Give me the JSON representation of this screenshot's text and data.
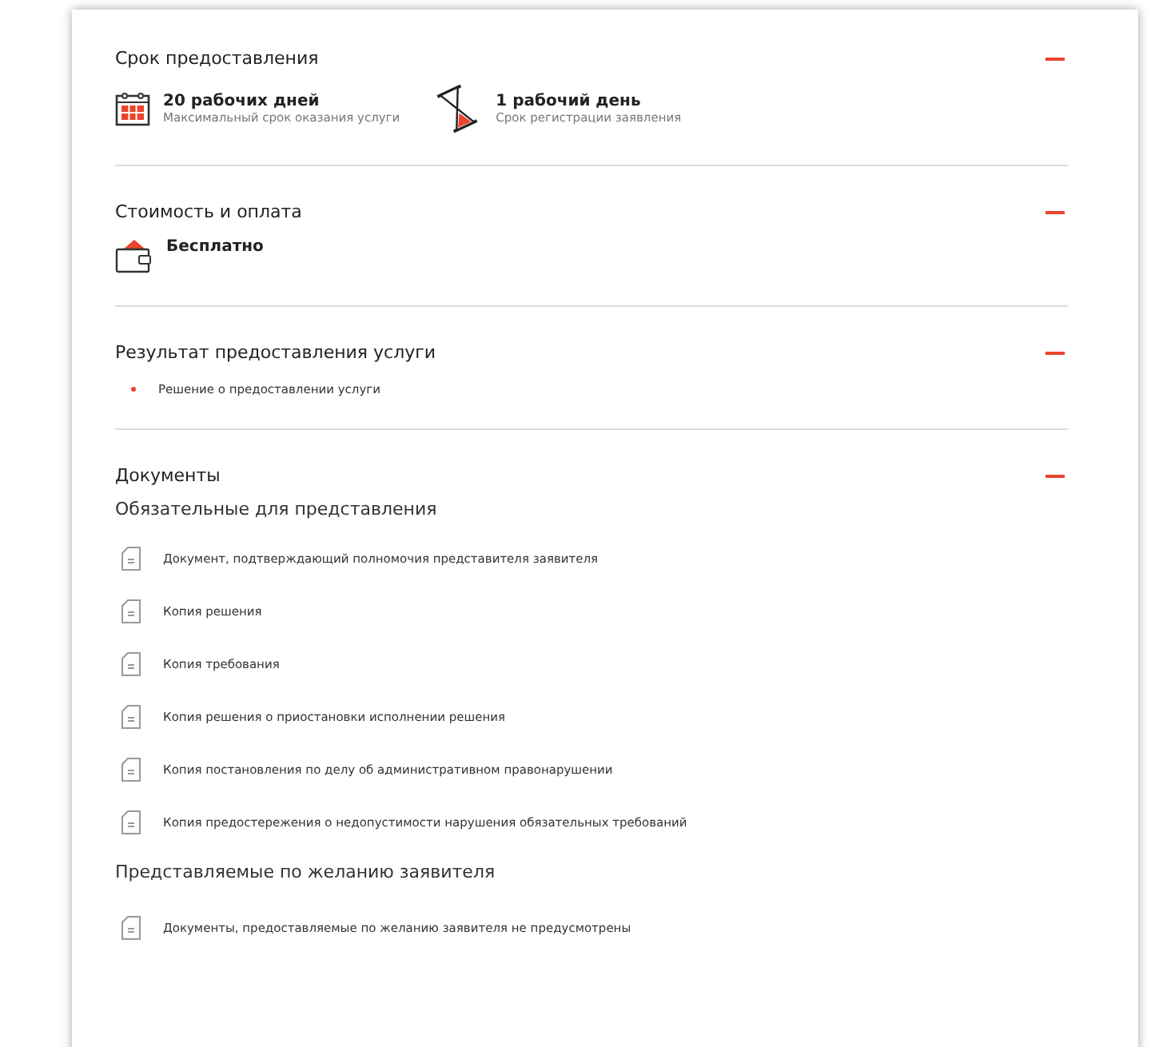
{
  "sections": [
    {
      "kind": "terms",
      "title": "Срок предоставления",
      "expanded": true,
      "items": [
        {
          "kind": "calendar",
          "value": "20 рабочих дней",
          "caption": "Максимальный срок оказания услуги"
        },
        {
          "kind": "hourglass",
          "value": "1 рабочий день",
          "caption": "Срок регистрации заявления"
        }
      ]
    },
    {
      "kind": "cost",
      "title": "Стоимость и оплата",
      "expanded": true,
      "value": "Бесплатно"
    },
    {
      "kind": "result",
      "title": "Результат предоставления услуги",
      "expanded": true,
      "bullets": [
        "Решение о предоставлении услуги"
      ]
    },
    {
      "kind": "documents",
      "title": "Документы",
      "expanded": true,
      "groups": [
        {
          "title": "Обязательные для представления",
          "docs": [
            "Документ, подтверждающий полномочия представителя заявителя",
            "Копия решения",
            "Копия требования",
            "Копия решения о приостановки исполнении решения",
            "Копия постановления по делу об административном правонарушении",
            "Копия предостережения о недопустимости нарушения обязательных требований"
          ]
        },
        {
          "title": "Представляемые по желанию заявителя",
          "docs": [
            "Документы, предоставляемые по желанию заявителя не предусмотрены"
          ]
        }
      ]
    }
  ]
}
